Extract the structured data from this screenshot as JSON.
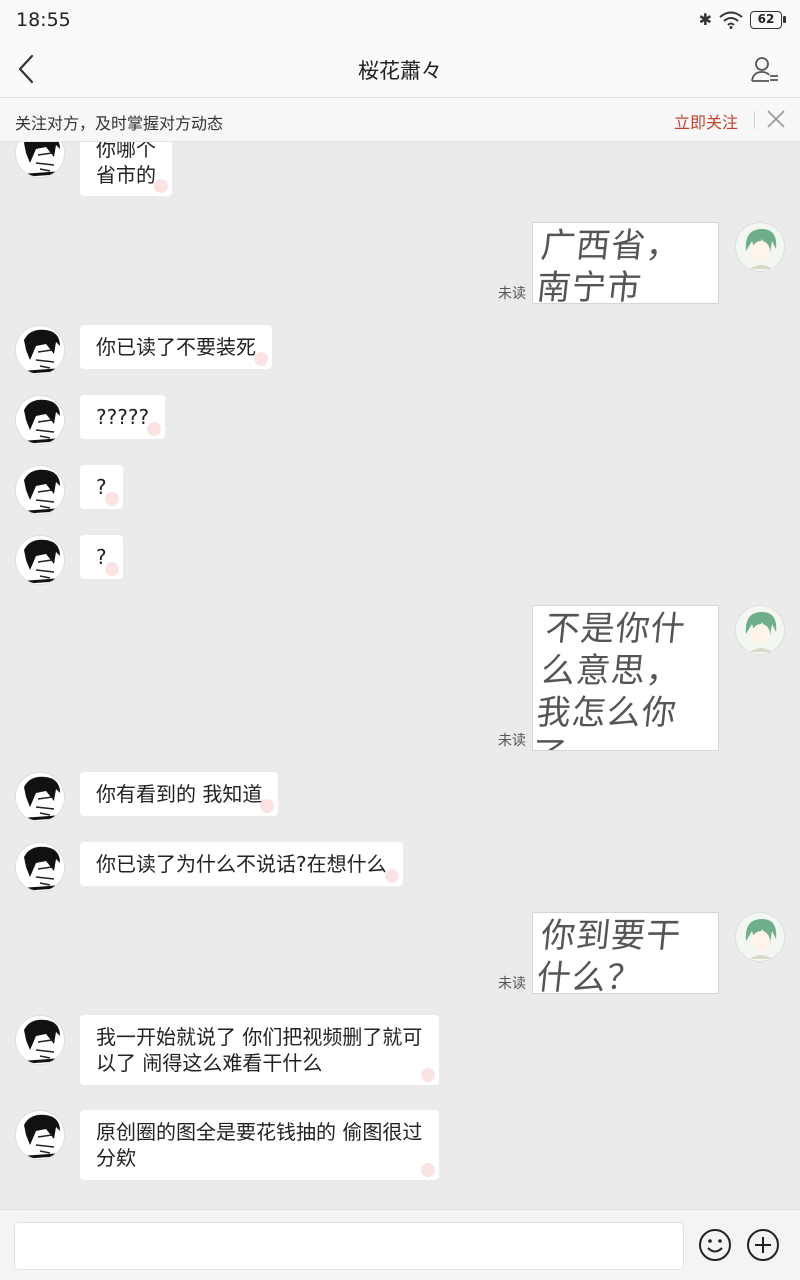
{
  "status_bar": {
    "time": "18:55",
    "battery": "62"
  },
  "header": {
    "title": "桜花蕭々"
  },
  "follow_banner": {
    "text": "关注对方，及时掌握对方动态",
    "follow_label": "立即关注"
  },
  "messages": [
    {
      "side": "left",
      "text": "你哪个\n省市的"
    },
    {
      "side": "right",
      "type": "handwriting-image",
      "text": "广西省，南宁市",
      "status": "未读"
    },
    {
      "side": "left",
      "text": "你已读了不要装死"
    },
    {
      "side": "left",
      "text": "?????"
    },
    {
      "side": "left",
      "text": "?"
    },
    {
      "side": "left",
      "text": "?"
    },
    {
      "side": "right",
      "type": "handwriting-image",
      "text": "不是你什么意思，我怎么你了",
      "status": "未读"
    },
    {
      "side": "left",
      "text": "你有看到的 我知道"
    },
    {
      "side": "left",
      "text": "你已读了为什么不说话?在想什么"
    },
    {
      "side": "right",
      "type": "handwriting-image",
      "text": "你到要干什么？",
      "status": "未读"
    },
    {
      "side": "left",
      "text": "我一开始就说了 你们把视频删了就可以了 闹得这么难看干什么"
    },
    {
      "side": "left",
      "text": "原创圈的图全是要花钱抽的 偷图很过分欸"
    }
  ],
  "icons": {
    "back": "chevron-left-icon",
    "profile": "person-settings-icon",
    "close": "close-icon",
    "emoji": "smiley-icon",
    "plus": "plus-circle-icon"
  },
  "colors": {
    "accent": "#c0442e",
    "background": "#ebebeb"
  }
}
